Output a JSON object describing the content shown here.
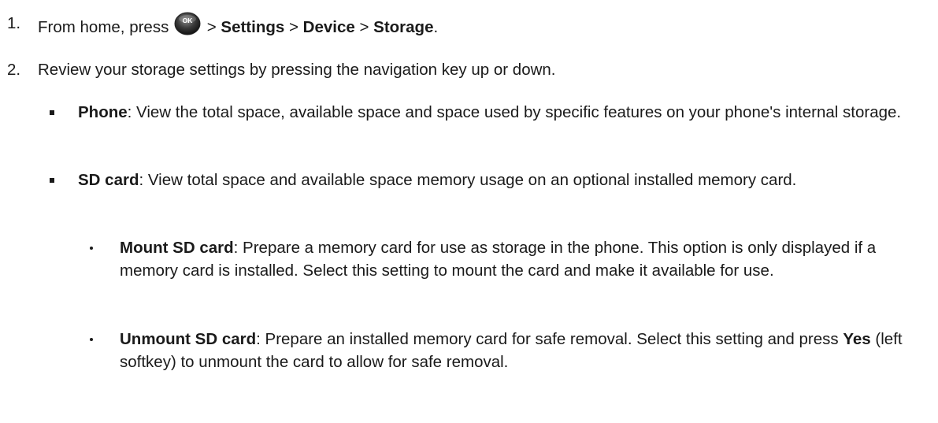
{
  "steps": [
    {
      "number": "1.",
      "prefix": "From home, press",
      "icon": "ok-button-icon",
      "icon_label": "OK",
      "path": [
        {
          "sep": " > ",
          "label": "Settings"
        },
        {
          "sep": " > ",
          "label": "Device"
        },
        {
          "sep": " > ",
          "label": "Storage"
        }
      ],
      "suffix": "."
    },
    {
      "number": "2.",
      "text": "Review your storage settings by pressing the navigation key up or down."
    }
  ],
  "options": [
    {
      "term": "Phone",
      "description": ": View the total space, available space and space used by specific features on your phone's internal storage."
    },
    {
      "term": "SD card",
      "description": ": View total space and available space memory usage on an optional installed memory card."
    }
  ],
  "sub_options": [
    {
      "term": "Mount SD card",
      "description": ": Prepare a memory card for use as storage in the phone. This option is only displayed if a memory card is installed. Select this setting to mount the card and make it available for use."
    },
    {
      "term": "Unmount SD card",
      "description_before": ": Prepare an installed memory card for safe removal. Select this setting and press ",
      "key": "Yes",
      "description_after": " (left softkey) to unmount the card to allow for safe removal."
    }
  ]
}
